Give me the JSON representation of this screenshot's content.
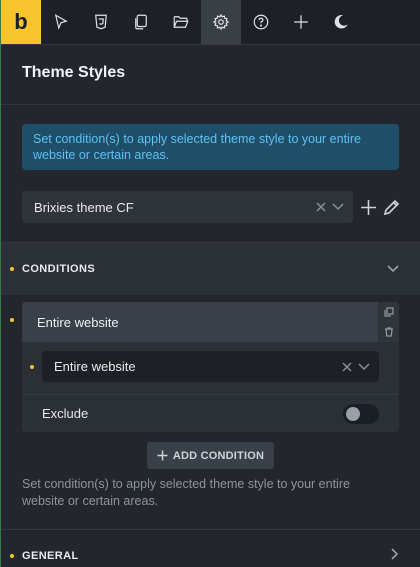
{
  "toolbar": {
    "logo": "b",
    "items": [
      {
        "icon": "cursor-icon"
      },
      {
        "icon": "css3-icon"
      },
      {
        "icon": "pages-icon"
      },
      {
        "icon": "folder-icon"
      },
      {
        "icon": "gear-icon",
        "active": true
      },
      {
        "icon": "help-icon"
      },
      {
        "icon": "plus-icon"
      },
      {
        "icon": "moon-icon"
      }
    ]
  },
  "panel": {
    "title": "Theme Styles",
    "info": "Set condition(s) to apply selected theme style to your entire website or certain areas.",
    "style_select": {
      "value": "Brixies theme CF"
    }
  },
  "conditions": {
    "heading": "CONDITIONS",
    "card": {
      "title": "Entire website",
      "select_value": "Entire website",
      "exclude_label": "Exclude",
      "exclude_on": false
    },
    "add_button": "ADD CONDITION",
    "help": "Set condition(s) to apply selected theme style to your entire website or certain areas."
  },
  "general": {
    "heading": "GENERAL"
  },
  "colors": {
    "accent": "#f7c42c",
    "info_bg": "#1f4e69",
    "info_text": "#5ec2f2"
  }
}
